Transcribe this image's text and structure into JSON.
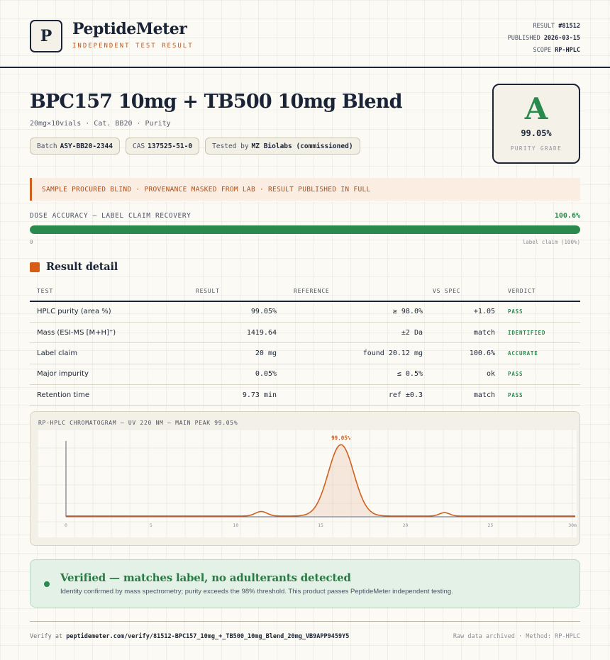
{
  "header": {
    "logo_letter": "P",
    "brand": "PeptideMeter",
    "brand_sub": "INDEPENDENT TEST RESULT",
    "meta": {
      "result_label": "RESULT",
      "result_value": "#81512",
      "published_label": "PUBLISHED",
      "published_value": "2026-03-15",
      "scope_label": "SCOPE",
      "scope_value": "RP-HPLC"
    }
  },
  "product": {
    "title": "BPC157 10mg + TB500 10mg Blend",
    "subtitle": "20mg×10vials · Cat. BB20 · Purity",
    "chips": {
      "batch_label": "Batch",
      "batch_value": "ASY-BB20-2344",
      "cas_label": "CAS",
      "cas_value": "137525-51-0",
      "tested_label": "Tested by",
      "tested_value": "MZ Biolabs (commissioned)"
    }
  },
  "grade": {
    "letter": "A",
    "value": "99.05%",
    "label": "PURITY GRADE",
    "color": "#2a8a4e"
  },
  "notice": "SAMPLE PROCURED BLIND · PROVENANCE MASKED FROM LAB · RESULT PUBLISHED IN FULL",
  "dose": {
    "label": "DOSE ACCURACY — LABEL CLAIM RECOVERY",
    "percent_text": "100.6%",
    "fill_fraction": 1.0,
    "min_label": "0",
    "max_label": "label claim (100%)"
  },
  "results": {
    "title": "Result detail",
    "headers": [
      "TEST",
      "RESULT",
      "REFERENCE",
      "VS SPEC",
      "VERDICT"
    ],
    "rows": [
      {
        "test": "HPLC purity (area %)",
        "result": "99.05%",
        "reference": "≥ 98.0%",
        "vs_spec": "+1.05",
        "verdict": "PASS"
      },
      {
        "test": "Mass (ESI-MS [M+H]⁺)",
        "result": "1419.64",
        "reference": "±2 Da",
        "vs_spec": "match",
        "verdict": "IDENTIFIED"
      },
      {
        "test": "Label claim",
        "result": "20 mg",
        "reference": "found 20.12 mg",
        "vs_spec": "100.6%",
        "verdict": "ACCURATE"
      },
      {
        "test": "Major impurity",
        "result": "0.05%",
        "reference": "≤ 0.5%",
        "vs_spec": "ok",
        "verdict": "PASS"
      },
      {
        "test": "Retention time",
        "result": "9.73 min",
        "reference": "ref ±0.3",
        "vs_spec": "match",
        "verdict": "PASS"
      }
    ]
  },
  "chromatogram": {
    "title": "RP-HPLC CHROMATOGRAM — UV 220 NM — MAIN PEAK 99.05%",
    "peak_label": "99.05%",
    "x_unit": "min"
  },
  "chart_data": {
    "type": "line",
    "title": "RP-HPLC CHROMATOGRAM — UV 220 NM — MAIN PEAK 99.05%",
    "xlabel": "",
    "ylabel": "",
    "xlim": [
      0,
      30
    ],
    "ylim": [
      0,
      1
    ],
    "x_ticks": [
      0,
      5,
      10,
      15,
      20,
      25,
      30
    ],
    "series": [
      {
        "baseline": 0.01,
        "peaks": [
          {
            "x": 11.5,
            "height": 0.06,
            "width": 0.35
          },
          {
            "x": 16.2,
            "height": 0.94,
            "width": 0.75,
            "label": "99.05%"
          },
          {
            "x": 22.3,
            "height": 0.045,
            "width": 0.3
          }
        ]
      }
    ],
    "color": "#d0601f"
  },
  "verified": {
    "title": "Verified — matches label, no adulterants detected",
    "description": "Identity confirmed by mass spectrometry; purity exceeds the 98% threshold. This product passes PeptideMeter independent testing."
  },
  "footer": {
    "verify_label": "Verify at",
    "verify_url": "peptidemeter.com/verify/81512-BPC157_10mg_+_TB500_10mg_Blend_20mg_VB9APP9459Y5",
    "right_text": "Raw data archived · Method: RP-HPLC"
  }
}
